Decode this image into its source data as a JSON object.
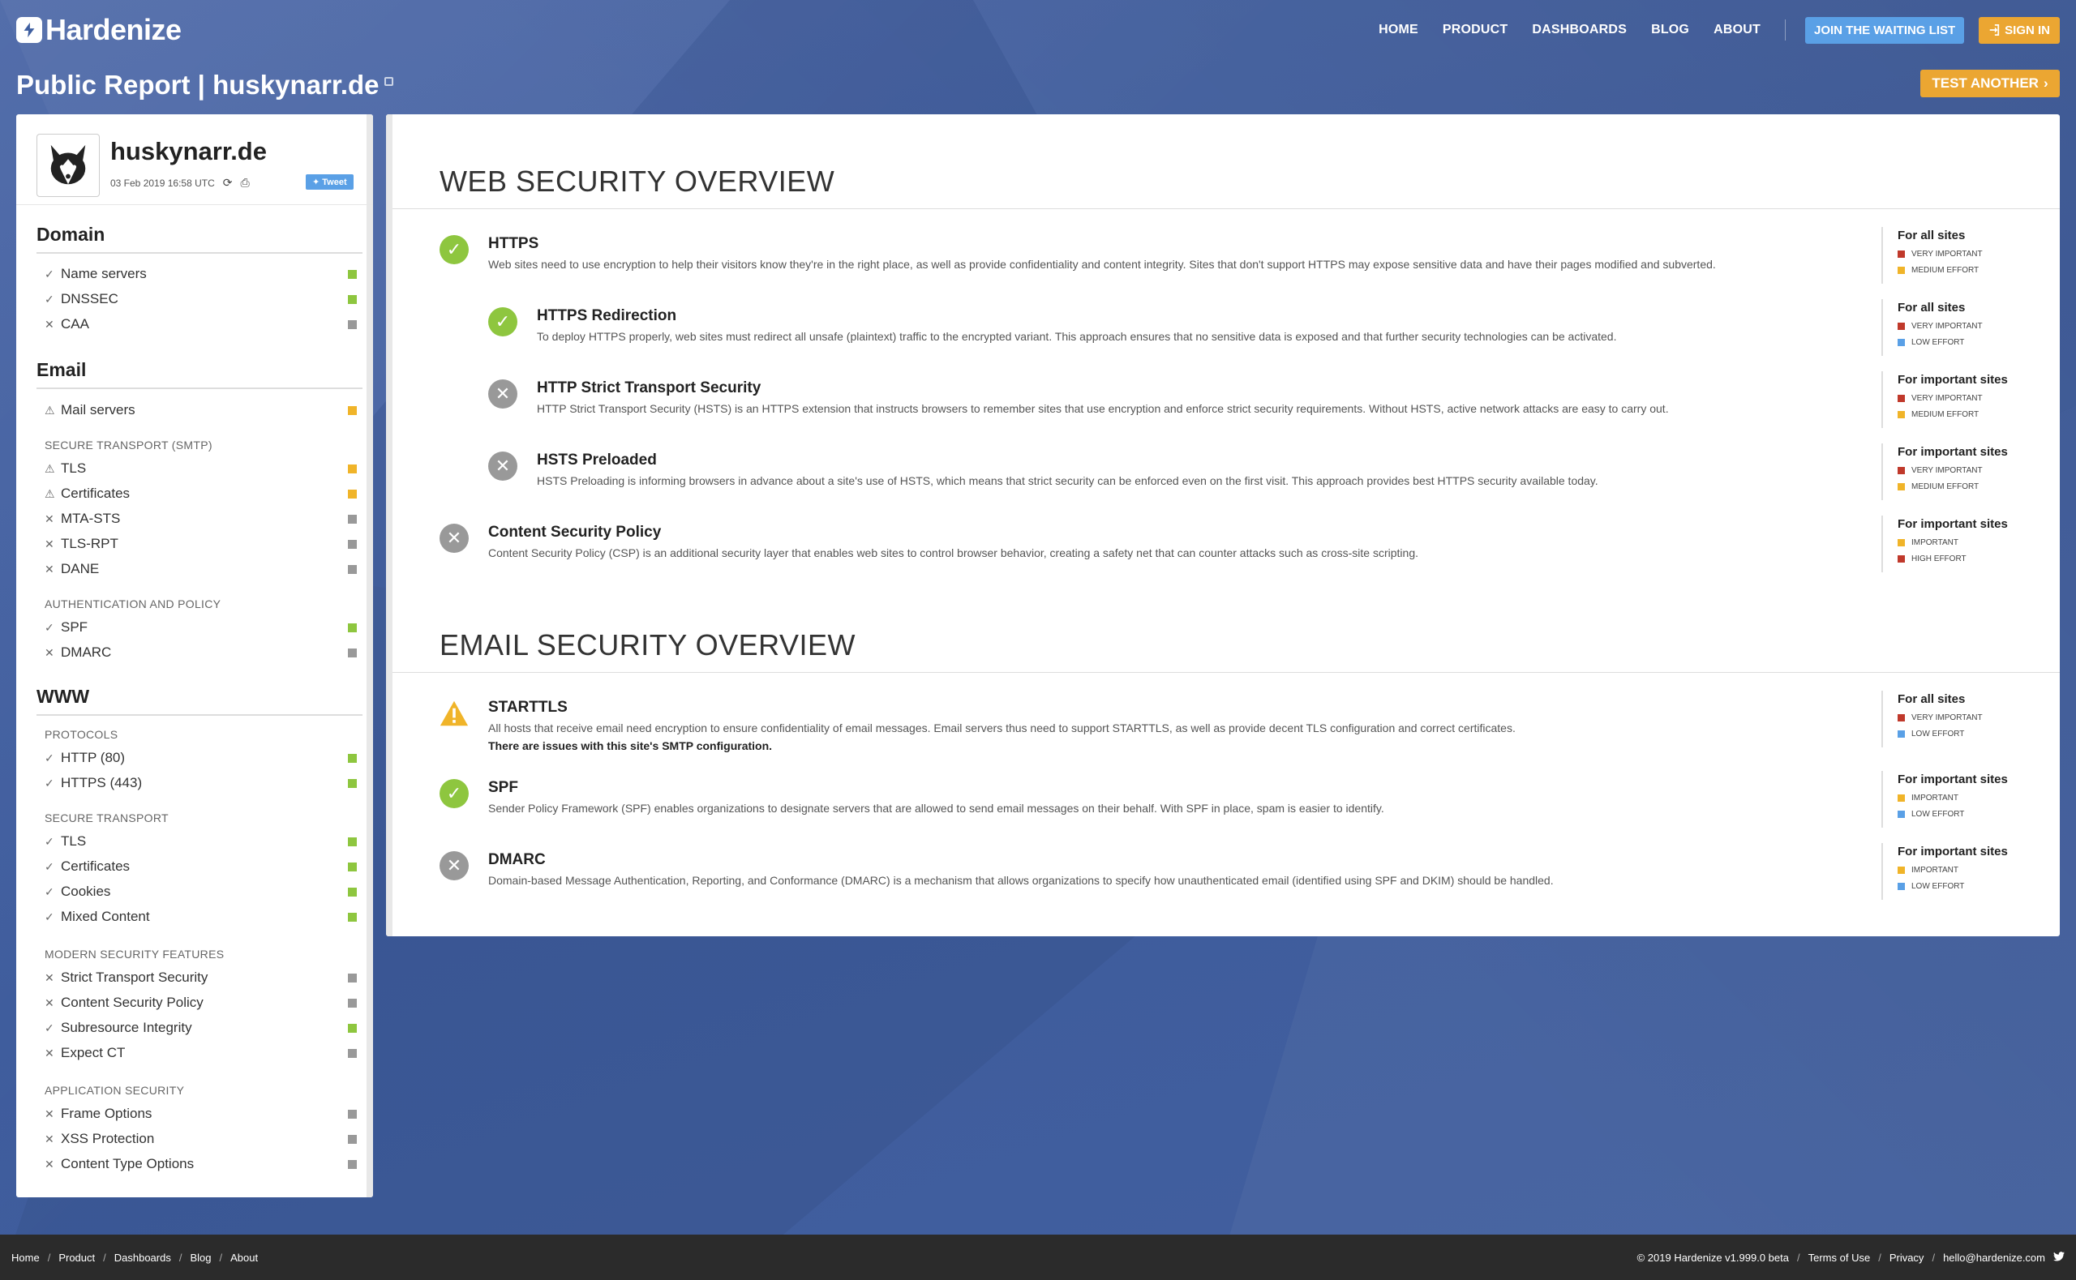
{
  "brand": {
    "name": "Hardenize"
  },
  "nav": {
    "links": [
      "HOME",
      "PRODUCT",
      "DASHBOARDS",
      "BLOG",
      "ABOUT"
    ],
    "waiting_list": "JOIN THE WAITING LIST",
    "sign_in": "SIGN IN"
  },
  "page": {
    "title": "Public Report | huskynarr.de",
    "test_another": "TEST ANOTHER"
  },
  "sidebar": {
    "domain": "huskynarr.de",
    "date": "03 Feb 2019 16:58 UTC",
    "tweet": "Tweet",
    "sections": {
      "domain": {
        "title": "Domain",
        "items": [
          {
            "label": "Name servers",
            "mark": "check",
            "status": "green"
          },
          {
            "label": "DNSSEC",
            "mark": "check",
            "status": "green"
          },
          {
            "label": "CAA",
            "mark": "cross",
            "status": "grey"
          }
        ]
      },
      "email": {
        "title": "Email",
        "items": [
          {
            "label": "Mail servers",
            "mark": "warn",
            "status": "yellow"
          }
        ],
        "secure_transport_label": "SECURE TRANSPORT (SMTP)",
        "secure_transport": [
          {
            "label": "TLS",
            "mark": "warn",
            "status": "yellow"
          },
          {
            "label": "Certificates",
            "mark": "warn",
            "status": "yellow"
          },
          {
            "label": "MTA-STS",
            "mark": "cross",
            "status": "grey"
          },
          {
            "label": "TLS-RPT",
            "mark": "cross",
            "status": "grey"
          },
          {
            "label": "DANE",
            "mark": "cross",
            "status": "grey"
          }
        ],
        "auth_label": "AUTHENTICATION AND POLICY",
        "auth": [
          {
            "label": "SPF",
            "mark": "check",
            "status": "green"
          },
          {
            "label": "DMARC",
            "mark": "cross",
            "status": "grey"
          }
        ]
      },
      "www": {
        "title": "WWW",
        "protocols_label": "PROTOCOLS",
        "protocols": [
          {
            "label": "HTTP (80)",
            "mark": "check",
            "status": "green"
          },
          {
            "label": "HTTPS (443)",
            "mark": "check",
            "status": "green"
          }
        ],
        "secure_transport_label": "SECURE TRANSPORT",
        "secure_transport": [
          {
            "label": "TLS",
            "mark": "check",
            "status": "green"
          },
          {
            "label": "Certificates",
            "mark": "check",
            "status": "green"
          },
          {
            "label": "Cookies",
            "mark": "check",
            "status": "green"
          },
          {
            "label": "Mixed Content",
            "mark": "check",
            "status": "green"
          }
        ],
        "modern_label": "MODERN SECURITY FEATURES",
        "modern": [
          {
            "label": "Strict Transport Security",
            "mark": "cross",
            "status": "grey"
          },
          {
            "label": "Content Security Policy",
            "mark": "cross",
            "status": "grey"
          },
          {
            "label": "Subresource Integrity",
            "mark": "check",
            "status": "green"
          },
          {
            "label": "Expect CT",
            "mark": "cross",
            "status": "grey"
          }
        ],
        "app_label": "APPLICATION SECURITY",
        "app": [
          {
            "label": "Frame Options",
            "mark": "cross",
            "status": "grey"
          },
          {
            "label": "XSS Protection",
            "mark": "cross",
            "status": "grey"
          },
          {
            "label": "Content Type Options",
            "mark": "cross",
            "status": "grey"
          }
        ]
      }
    }
  },
  "web_overview": {
    "heading": "WEB SECURITY OVERVIEW",
    "items": [
      {
        "title": "HTTPS",
        "status": "ok",
        "desc": "Web sites need to use encryption to help their visitors know they're in the right place, as well as provide confidentiality and content integrity. Sites that don't support HTTPS may expose sensitive data and have their pages modified and subverted.",
        "meta_title": "For all sites",
        "importance": "VERY IMPORTANT",
        "imp_color": "red",
        "effort": "MEDIUM EFFORT",
        "eff_color": "yellow"
      },
      {
        "title": "HTTPS Redirection",
        "status": "ok",
        "desc": "To deploy HTTPS properly, web sites must redirect all unsafe (plaintext) traffic to the encrypted variant. This approach ensures that no sensitive data is exposed and that further security technologies can be activated.",
        "meta_title": "For all sites",
        "importance": "VERY IMPORTANT",
        "imp_color": "red",
        "effort": "LOW EFFORT",
        "eff_color": "blue"
      },
      {
        "title": "HTTP Strict Transport Security",
        "status": "no",
        "desc": "HTTP Strict Transport Security (HSTS) is an HTTPS extension that instructs browsers to remember sites that use encryption and enforce strict security requirements. Without HSTS, active network attacks are easy to carry out.",
        "meta_title": "For important sites",
        "importance": "VERY IMPORTANT",
        "imp_color": "red",
        "effort": "MEDIUM EFFORT",
        "eff_color": "yellow"
      },
      {
        "title": "HSTS Preloaded",
        "status": "no",
        "desc": "HSTS Preloading is informing browsers in advance about a site's use of HSTS, which means that strict security can be enforced even on the first visit. This approach provides best HTTPS security available today.",
        "meta_title": "For important sites",
        "importance": "VERY IMPORTANT",
        "imp_color": "red",
        "effort": "MEDIUM EFFORT",
        "eff_color": "yellow"
      },
      {
        "title": "Content Security Policy",
        "status": "no",
        "desc": "Content Security Policy (CSP) is an additional security layer that enables web sites to control browser behavior, creating a safety net that can counter attacks such as cross-site scripting.",
        "meta_title": "For important sites",
        "importance": "IMPORTANT",
        "imp_color": "yellow",
        "effort": "HIGH EFFORT",
        "eff_color": "red"
      }
    ]
  },
  "email_overview": {
    "heading": "EMAIL SECURITY OVERVIEW",
    "items": [
      {
        "title": "STARTTLS",
        "status": "warn",
        "desc": "All hosts that receive email need encryption to ensure confidentiality of email messages. Email servers thus need to support STARTTLS, as well as provide decent TLS configuration and correct certificates.",
        "note": "There are issues with this site's SMTP configuration.",
        "meta_title": "For all sites",
        "importance": "VERY IMPORTANT",
        "imp_color": "red",
        "effort": "LOW EFFORT",
        "eff_color": "blue"
      },
      {
        "title": "SPF",
        "status": "ok",
        "desc": "Sender Policy Framework (SPF) enables organizations to designate servers that are allowed to send email messages on their behalf. With SPF in place, spam is easier to identify.",
        "meta_title": "For important sites",
        "importance": "IMPORTANT",
        "imp_color": "yellow",
        "effort": "LOW EFFORT",
        "eff_color": "blue"
      },
      {
        "title": "DMARC",
        "status": "no",
        "desc": "Domain-based Message Authentication, Reporting, and Conformance (DMARC) is a mechanism that allows organizations to specify how unauthenticated email (identified using SPF and DKIM) should be handled.",
        "meta_title": "For important sites",
        "importance": "IMPORTANT",
        "imp_color": "yellow",
        "effort": "LOW EFFORT",
        "eff_color": "blue"
      }
    ]
  },
  "footer": {
    "links": [
      "Home",
      "Product",
      "Dashboards",
      "Blog",
      "About"
    ],
    "copyright": "© 2019 Hardenize v1.999.0 beta",
    "terms": "Terms of Use",
    "privacy": "Privacy",
    "email": "hello@hardenize.com"
  }
}
